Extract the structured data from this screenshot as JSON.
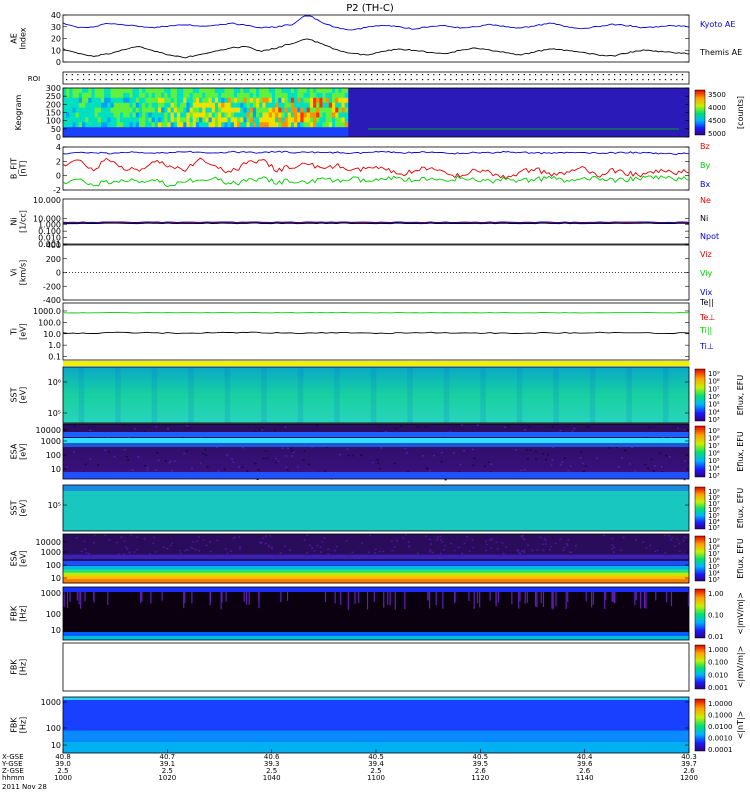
{
  "title": "P2 (TH-C)",
  "colors": {
    "blue": "#0000dd",
    "red": "#e00000",
    "green": "#00cc00",
    "black": "#000000"
  },
  "chart_data": [
    {
      "type": "line",
      "ylabel": "AE Index",
      "ylim": [
        0,
        40
      ],
      "yticks": [
        "0",
        "10",
        "20",
        "30",
        "40"
      ],
      "series": [
        {
          "name": "Kyoto AE",
          "color": "blue",
          "values": [
            33,
            29,
            30,
            33,
            32,
            30,
            29,
            31,
            32,
            30,
            31,
            33,
            31,
            29,
            30,
            32,
            41,
            33,
            29,
            27,
            30,
            31,
            30,
            28,
            30,
            31,
            29,
            30,
            32,
            30,
            29,
            31,
            33,
            30,
            28,
            30,
            32,
            31,
            29,
            30,
            31,
            30
          ]
        },
        {
          "name": "Themis AE",
          "color": "black",
          "values": [
            11,
            7,
            5,
            7,
            11,
            13,
            9,
            6,
            4,
            6,
            9,
            12,
            13,
            9,
            12,
            16,
            20,
            15,
            10,
            7,
            6,
            9,
            11,
            10,
            8,
            7,
            10,
            12,
            10,
            8,
            6,
            9,
            11,
            10,
            8,
            6,
            5,
            8,
            10,
            9,
            8,
            7
          ]
        }
      ]
    },
    {
      "type": "table",
      "ylabel": "ROI"
    },
    {
      "type": "heatmap",
      "ylabel": "Keogram",
      "ylim": [
        0,
        300
      ],
      "yticks": [
        "0",
        "50",
        "100",
        "150",
        "200",
        "250",
        "300"
      ],
      "colorbar": {
        "label": "[counts]",
        "ticks": [
          "3500",
          "4000",
          "4500",
          "5000"
        ]
      }
    },
    {
      "type": "line",
      "ylabel": "B_FIT [nT]",
      "ylim": [
        -3,
        5
      ],
      "yticks": [
        "-2",
        "0",
        "2",
        "4"
      ],
      "series": [
        {
          "name": "Bz",
          "color": "red",
          "values": [
            1.5,
            2.4,
            0.8,
            2.9,
            1.2,
            0.4,
            2.2,
            1.6,
            0.9,
            2.5,
            1.1,
            0.3,
            1.9,
            2.6,
            0.7,
            1.4,
            2.1,
            0.8,
            1.6,
            0.5,
            1.2,
            0.9,
            -0.2,
            0.6,
            1.0,
            0.3,
            -0.5,
            0.8,
            0.2,
            -0.8,
            0.5,
            0.9,
            -0.4,
            0.3,
            1.1,
            -0.6,
            0.7,
            0.1,
            -0.3,
            0.6,
            0.2,
            0.4
          ]
        },
        {
          "name": "By",
          "color": "green",
          "values": [
            -1.8,
            -1.2,
            -2.0,
            -1.5,
            -0.9,
            -1.7,
            -1.3,
            -2.1,
            -1.1,
            -1.6,
            -1.0,
            -1.9,
            -1.4,
            -0.8,
            -1.6,
            -1.2,
            -1.5,
            -1.0,
            -1.3,
            -0.9,
            -1.4,
            -1.1,
            -0.8,
            -1.2,
            -1.0,
            -1.3,
            -0.7,
            -1.1,
            -1.4,
            -0.9,
            -1.2,
            -1.0,
            -0.8,
            -1.3,
            -1.1,
            -0.9,
            -1.2,
            -1.0,
            -0.8,
            -0.6,
            -0.9,
            -1.0
          ]
        },
        {
          "name": "Bx",
          "color": "blue",
          "values": [
            3.7,
            3.9,
            4.0,
            3.8,
            4.1,
            3.9,
            3.8,
            4.0,
            4.2,
            3.9,
            3.8,
            4.1,
            4.0,
            3.9,
            4.2,
            4.0,
            4.1,
            3.9,
            4.0,
            3.8,
            4.0,
            4.1,
            3.9,
            4.0,
            4.0,
            3.9,
            3.8,
            4.0,
            3.9,
            4.1,
            4.0,
            3.9,
            3.8,
            4.0,
            3.9,
            3.8,
            3.9,
            4.0,
            3.9,
            3.8,
            3.7,
            3.8
          ]
        }
      ]
    },
    {
      "type": "line",
      "ylabel": "Ni [1/cc]",
      "scale": "log",
      "ylim": [
        0.001,
        10000
      ],
      "yticks": [
        "0.001",
        "0.010",
        "0.100",
        "1.000",
        "10.000"
      ],
      "series": [
        {
          "name": "Ne",
          "color": "red",
          "values": [
            2,
            2,
            2,
            2,
            2,
            2,
            2,
            2,
            2,
            2,
            2,
            2,
            2,
            2,
            2,
            2,
            2,
            2,
            2,
            2,
            2,
            2
          ]
        },
        {
          "name": "Ni",
          "color": "black",
          "values": [
            1.6,
            1.6,
            1.6,
            1.6,
            1.6,
            1.6,
            1.6,
            1.6,
            1.6,
            1.6,
            1.6,
            1.6,
            1.6,
            1.6,
            1.6,
            1.6,
            1.6,
            1.6,
            1.6,
            1.6,
            1.6,
            1.6
          ]
        },
        {
          "name": "Npot",
          "color": "blue",
          "values": [
            2.5,
            2.5,
            2.5,
            2.5,
            2.5,
            2.5,
            2.5,
            2.5,
            2.5,
            2.5,
            2.5,
            2.5,
            2.5,
            2.5,
            2.5,
            2.5,
            2.5,
            2.5,
            2.5,
            2.5,
            2.5,
            2.5
          ]
        }
      ]
    },
    {
      "type": "line",
      "ylabel": "Vi [km/s]",
      "ylim": [
        -500,
        500
      ],
      "yticks": [
        "-400",
        "-200",
        "0",
        "200",
        "400"
      ],
      "series": [
        {
          "name": "Viz",
          "color": "red",
          "values": []
        },
        {
          "name": "Viy",
          "color": "green",
          "values": []
        },
        {
          "name": "Vix",
          "color": "blue",
          "values": []
        }
      ]
    },
    {
      "type": "line",
      "ylabel": "Ti [eV]",
      "scale": "log",
      "ylim": [
        0.05,
        5000
      ],
      "yticks": [
        "0.1",
        "1.0",
        "10.0",
        "100.0",
        "1000.0"
      ],
      "series": [
        {
          "name": "Te||",
          "color": "black",
          "values": []
        },
        {
          "name": "Te⊥",
          "color": "red",
          "values": []
        },
        {
          "name": "Ti||",
          "color": "green",
          "values": [
            700,
            700,
            700,
            700,
            700,
            700,
            700,
            700,
            700,
            700,
            700,
            700,
            700,
            700,
            700,
            700,
            700,
            700,
            700,
            700,
            700,
            700
          ]
        },
        {
          "name": "Ti⊥",
          "color": "blue",
          "values": []
        },
        {
          "name": "Te",
          "color": "black",
          "values": [
            12,
            11,
            13,
            12,
            11,
            12,
            13,
            12,
            11,
            12,
            12,
            11,
            13,
            12,
            12,
            11,
            12,
            12,
            13,
            12,
            11,
            12
          ]
        }
      ]
    },
    {
      "type": "heatmap",
      "ylabel": "SST [eV]",
      "yticks": [
        "10⁵",
        "10⁶"
      ],
      "colorbar": {
        "label": "Eflux, EFU",
        "ticks": [
          "10⁹",
          "10⁸",
          "10⁷",
          "10⁶",
          "10⁵",
          "10⁴",
          "10³"
        ]
      }
    },
    {
      "type": "heatmap",
      "ylabel": "ESA [eV]",
      "yticks": [
        "10",
        "100",
        "1000",
        "10000"
      ],
      "colorbar": {
        "label": "Eflux, EFU",
        "ticks": [
          "10⁹",
          "10⁸",
          "10⁷",
          "10⁶",
          "10⁵",
          "10⁴",
          "10³"
        ]
      }
    },
    {
      "type": "heatmap",
      "ylabel": "SST [eV]",
      "yticks": [
        "10⁵"
      ],
      "colorbar": {
        "label": "Eflux, EFU",
        "ticks": [
          "10⁹",
          "10⁸",
          "10⁷",
          "10⁶",
          "10⁵",
          "10⁴",
          "10³"
        ]
      }
    },
    {
      "type": "heatmap",
      "ylabel": "ESA [eV]",
      "yticks": [
        "10",
        "100",
        "1000",
        "10000"
      ],
      "colorbar": {
        "label": "Eflux, EFU",
        "ticks": [
          "10⁹",
          "10⁸",
          "10⁷",
          "10⁶",
          "10⁵",
          "10⁴",
          "10³"
        ]
      }
    },
    {
      "type": "heatmap",
      "ylabel": "FBK [Hz]",
      "yticks": [
        "10",
        "100",
        "1000"
      ],
      "colorbar": {
        "label": "<|mV/m|>",
        "ticks": [
          "1.00",
          "0.10",
          "0.01"
        ]
      }
    },
    {
      "type": "heatmap",
      "ylabel": "FBK [Hz]",
      "yticks": [],
      "colorbar": {
        "label": "<|mV/m|>",
        "ticks": [
          "1.000",
          "0.100",
          "0.010",
          "0.001"
        ]
      }
    },
    {
      "type": "heatmap",
      "ylabel": "FBK [Hz]",
      "yticks": [
        "10",
        "100",
        "1000"
      ],
      "colorbar": {
        "label": "<|nT|>",
        "ticks": [
          "1.0000",
          "0.1000",
          "0.0100",
          "0.0010",
          "0.0001"
        ]
      }
    }
  ],
  "x_axis": {
    "row_labels": [
      "X-GSE",
      "Y-GSE",
      "Z-GSE",
      "hhmm",
      "2011 Nov 28"
    ],
    "ticks": [
      [
        "40.8",
        "39.0",
        "2.5",
        "1000"
      ],
      [
        "40.7",
        "39.1",
        "2.5",
        "1020"
      ],
      [
        "40.6",
        "39.3",
        "2.5",
        "1040"
      ],
      [
        "40.5",
        "39.4",
        "2.5",
        "1100"
      ],
      [
        "40.5",
        "39.5",
        "2.6",
        "1120"
      ],
      [
        "40.4",
        "39.6",
        "2.6",
        "1140"
      ],
      [
        "40.3",
        "39.7",
        "2.6",
        "1200"
      ]
    ]
  }
}
